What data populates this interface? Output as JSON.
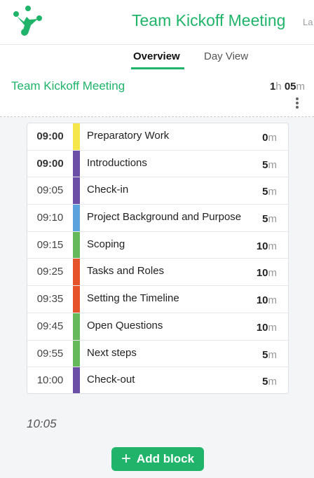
{
  "header": {
    "title": "Team Kickoff Meeting",
    "title_overflow": "La",
    "brand_color": "#1fb46a"
  },
  "tabs": [
    {
      "label": "Overview",
      "active": true
    },
    {
      "label": "Day View",
      "active": false
    }
  ],
  "summary": {
    "name": "Team Kickoff Meeting",
    "duration_hours": "1",
    "hours_unit": "h",
    "duration_minutes": "05",
    "minutes_unit": "m",
    "menu_icon": "kebab-menu-icon"
  },
  "agenda": [
    {
      "time": "09:00",
      "bold_time": true,
      "title": "Preparatory Work",
      "duration": "0",
      "unit": "m",
      "color": "#f5e64b"
    },
    {
      "time": "09:00",
      "bold_time": true,
      "title": "Introductions",
      "duration": "5",
      "unit": "m",
      "color": "#6b4fa6"
    },
    {
      "time": "09:05",
      "bold_time": false,
      "title": "Check-in",
      "duration": "5",
      "unit": "m",
      "color": "#6b4fa6"
    },
    {
      "time": "09:10",
      "bold_time": false,
      "title": "Project Background and Purpose",
      "duration": "5",
      "unit": "m",
      "color": "#5aa3dc"
    },
    {
      "time": "09:15",
      "bold_time": false,
      "title": "Scoping",
      "duration": "10",
      "unit": "m",
      "color": "#66b95a"
    },
    {
      "time": "09:25",
      "bold_time": false,
      "title": "Tasks and Roles",
      "duration": "10",
      "unit": "m",
      "color": "#e4532a"
    },
    {
      "time": "09:35",
      "bold_time": false,
      "title": "Setting the Timeline",
      "duration": "10",
      "unit": "m",
      "color": "#e4532a"
    },
    {
      "time": "09:45",
      "bold_time": false,
      "title": "Open Questions",
      "duration": "10",
      "unit": "m",
      "color": "#66b95a"
    },
    {
      "time": "09:55",
      "bold_time": false,
      "title": "Next steps",
      "duration": "5",
      "unit": "m",
      "color": "#66b95a"
    },
    {
      "time": "10:00",
      "bold_time": false,
      "title": "Check-out",
      "duration": "5",
      "unit": "m",
      "color": "#6b4fa6"
    }
  ],
  "end_time": "10:05",
  "add_button": {
    "label": "Add block",
    "icon": "plus-icon"
  }
}
